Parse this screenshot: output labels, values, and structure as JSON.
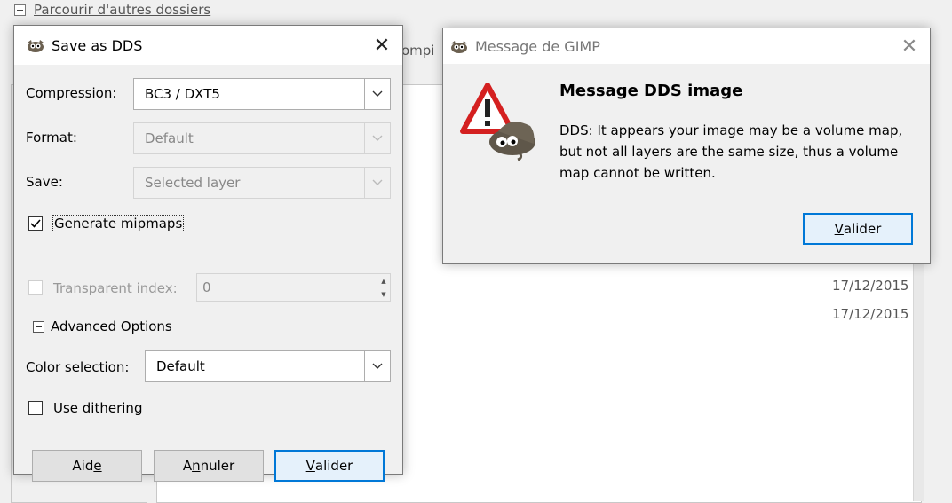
{
  "background": {
    "browse_label": "Parcourir d'autres dossiers",
    "tab_partial": "ompi",
    "dates": [
      "17/12/2015",
      "17/12/2015"
    ]
  },
  "save_dialog": {
    "title": "Save as DDS",
    "compression_label": "Compression:",
    "compression_value": "BC3 / DXT5",
    "format_label": "Format:",
    "format_value": "Default",
    "save_label": "Save:",
    "save_value": "Selected layer",
    "mipmaps_label": "Generate mipmaps",
    "mipmaps_checked": true,
    "transparent_label": "Transparent index:",
    "transparent_value": "0",
    "advanced_label": "Advanced Options",
    "color_selection_label": "Color selection:",
    "color_selection_value": "Default",
    "dithering_label": "Use dithering",
    "buttons": {
      "help": {
        "pre": "Aid",
        "mnemonic": "e",
        "post": ""
      },
      "cancel": {
        "pre": "A",
        "mnemonic": "n",
        "post": "nuler"
      },
      "ok": {
        "pre": "",
        "mnemonic": "V",
        "post": "alider"
      }
    }
  },
  "message_dialog": {
    "title": "Message de GIMP",
    "heading": "Message DDS image",
    "body_lines": [
      "DDS: It appears your image may be a volume map,",
      "but not all layers are the same size, thus a volume",
      "map cannot be written."
    ],
    "ok": {
      "pre": "",
      "mnemonic": "V",
      "post": "alider"
    }
  },
  "colors": {
    "accent": "#0078d7",
    "warning_red": "#d42020"
  }
}
